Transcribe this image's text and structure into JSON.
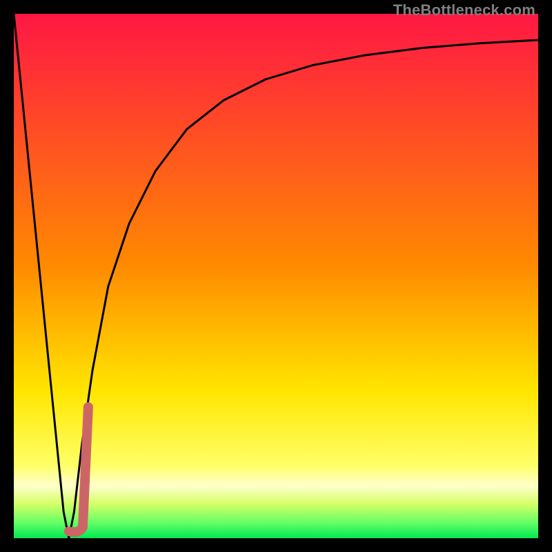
{
  "watermark": "TheBottleneck.com",
  "colors": {
    "background": "#000000",
    "curve": "#000000",
    "marker": "#CC6666",
    "gradient_top": "#FF1744",
    "gradient_mid_upper": "#FF8A00",
    "gradient_mid": "#FFE600",
    "gradient_band": "#FFFF99",
    "gradient_bottom": "#00E853"
  },
  "chart_data": {
    "type": "line",
    "title": "",
    "xlabel": "",
    "ylabel": "",
    "xlim": [
      0,
      100
    ],
    "ylim": [
      0,
      100
    ],
    "series": [
      {
        "name": "bottleneck-curve",
        "x": [
          0,
          2.5,
          5,
          7.5,
          9.5,
          10.5,
          11.5,
          13,
          15,
          18,
          22,
          27,
          33,
          40,
          48,
          57,
          67,
          78,
          89,
          100
        ],
        "values": [
          100,
          75,
          50,
          25,
          5,
          0,
          5,
          18,
          32,
          48,
          60,
          70,
          78,
          83.5,
          87.5,
          90.2,
          92.1,
          93.5,
          94.4,
          95
        ]
      }
    ],
    "annotations": [
      {
        "name": "marker-j",
        "shape": "j-hook",
        "x_range": [
          10.5,
          14.2
        ],
        "y_range": [
          0,
          25
        ]
      }
    ],
    "gradient_stops_percent": [
      {
        "pos": 0,
        "color": "#FF1744"
      },
      {
        "pos": 48,
        "color": "#FF8A00"
      },
      {
        "pos": 72,
        "color": "#FFE600"
      },
      {
        "pos": 86,
        "color": "#FFFF66"
      },
      {
        "pos": 90,
        "color": "#FFFFCC"
      },
      {
        "pos": 93.5,
        "color": "#D4FF66"
      },
      {
        "pos": 97,
        "color": "#66FF66"
      },
      {
        "pos": 100,
        "color": "#00E853"
      }
    ]
  }
}
